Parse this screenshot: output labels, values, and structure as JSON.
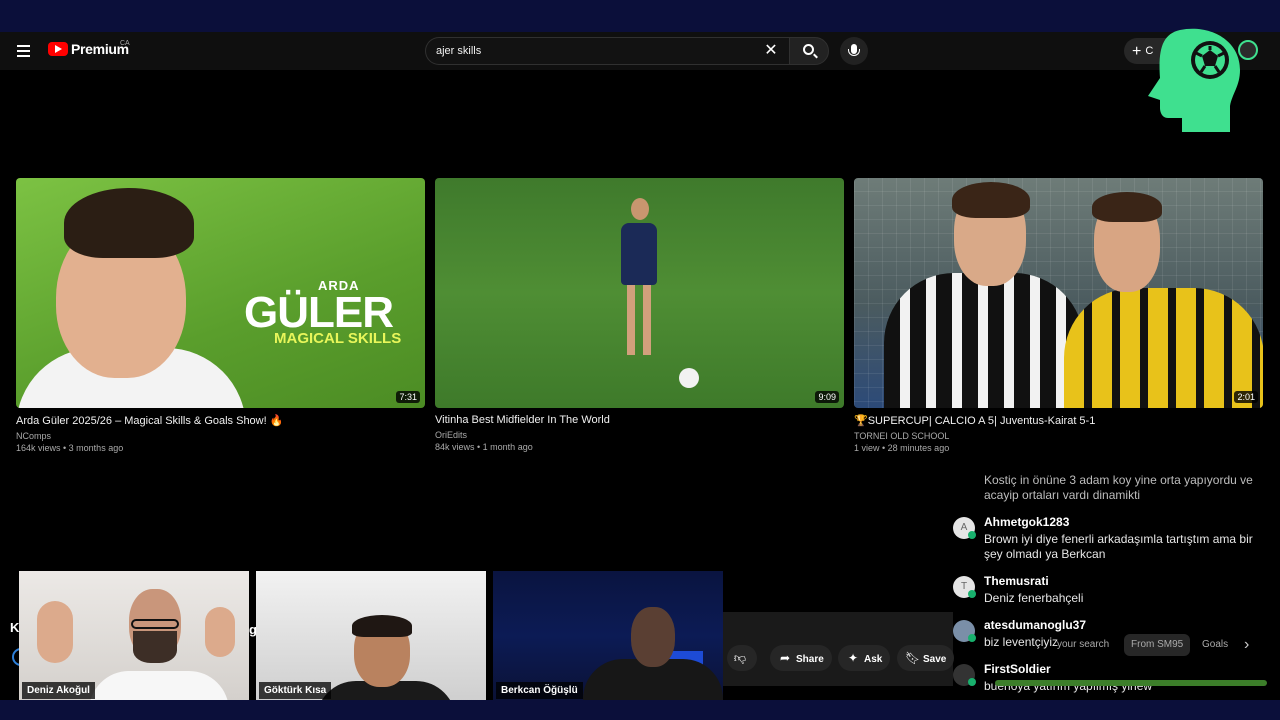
{
  "masthead": {
    "logo_text": "Premium",
    "region": "CA",
    "search_value": "ajer skills",
    "create_label": "C"
  },
  "videos": [
    {
      "title": "Arda Güler 2025/26 – Magical Skills & Goals Show! 🔥",
      "channel": "NComps",
      "meta": "164k views • 3 months ago",
      "duration": "7:31",
      "thumb_text": {
        "small": "ARDA",
        "big": "GÜLER",
        "sub": "MAGICAL SKILLS"
      }
    },
    {
      "title": "Vitinha Best Midfielder In The World",
      "channel": "OriEdits",
      "meta": "84k views • 1 month ago",
      "duration": "9:09"
    },
    {
      "title": "🏆SUPERCUP| CALCIO A 5| Juventus-Kairat 5-1",
      "channel": "TORNEI OLD SCHOOL",
      "meta": "1 view • 28 minutes ago",
      "duration": "2:01"
    }
  ],
  "chat": [
    {
      "user": "",
      "avatar": "",
      "message": "Kostiç in önüne 3 adam koy yine orta yapıyordu ve acayip ortaları vardı dinamikti"
    },
    {
      "user": "Ahmetgok1283",
      "avatar": "A",
      "message": "Brown iyi diye fenerli arkadaşımla tartıştım ama bir şey olmadı ya Berkcan"
    },
    {
      "user": "Themusrati",
      "avatar": "T",
      "message": "Deniz fenerbahçeli"
    },
    {
      "user": "atesdumanoglu37",
      "avatar": "",
      "message": "biz leventçiyiz"
    },
    {
      "user": "FirstSoldier",
      "avatar": "",
      "message": "buenoya yatırım yapılmış yinew"
    }
  ],
  "webcams": [
    {
      "name": "Deniz Akoğul"
    },
    {
      "name": "Göktürk Kısa"
    },
    {
      "name": "Berkcan Öğüşlü"
    }
  ],
  "watch_actions": {
    "share": "Share",
    "ask": "Ask",
    "save": "Save"
  },
  "chips": [
    "your search",
    "From SM95",
    "Goals"
  ],
  "partial_text": {
    "left": "K",
    "mid": "g"
  },
  "colors": {
    "brand_green": "#3fe08f",
    "youtube_red": "#ff0000",
    "band": "#0b0f3a"
  },
  "icons": [
    "menu-icon",
    "youtube-logo-icon",
    "clear-icon",
    "search-icon",
    "mic-icon",
    "plus-icon",
    "soccer-head-logo-icon",
    "dislike-icon",
    "share-icon",
    "sparkle-icon",
    "bookmark-icon",
    "chevron-right-icon"
  ]
}
